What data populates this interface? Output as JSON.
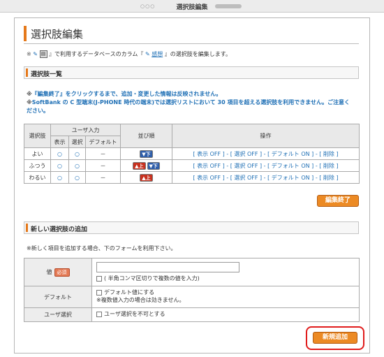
{
  "window": {
    "title": "選択肢編集"
  },
  "page": {
    "heading": "選択肢編集"
  },
  "intro": {
    "prefix": "※",
    "text_before_link": "』で利用するデータベースのカラム『",
    "link_label": "感想",
    "text_after_link": "』の選択肢を編集します。"
  },
  "section_list": {
    "title": "選択肢一覧"
  },
  "notes": [
    "『編集終了』をクリックするまで、追加・変更した情報は反映されません。",
    "SoftBank の C 型端末(J-PHONE 時代の端末)では選択リストにおいて 30 項目を超える選択肢を利用できません。ご注意ください。"
  ],
  "table": {
    "headers": {
      "choice": "選択肢",
      "user_input": "ユーザ入力",
      "display": "表示",
      "select": "選択",
      "default": "デフォルト",
      "order": "並び順",
      "operation": "操作"
    },
    "rows": [
      {
        "label": "よい",
        "display": "○",
        "select": "○",
        "default": "－",
        "order": [
          "▼下"
        ],
        "ops": {
          "show": "表示 OFF",
          "select": "選択 OFF",
          "default": "デフォルト ON",
          "delete": "削除"
        }
      },
      {
        "label": "ふつう",
        "display": "○",
        "select": "○",
        "default": "－",
        "order": [
          "▲上",
          "▼下"
        ],
        "ops": {
          "show": "表示 OFF",
          "select": "選択 OFF",
          "default": "デフォルト ON",
          "delete": "削除"
        }
      },
      {
        "label": "わるい",
        "display": "○",
        "select": "○",
        "default": "－",
        "order": [
          "▲上"
        ],
        "ops": {
          "show": "表示 OFF",
          "select": "選択 OFF",
          "default": "デフォルト ON",
          "delete": "削除"
        }
      }
    ]
  },
  "buttons": {
    "finish_edit": "編集終了",
    "add_new": "新規追加"
  },
  "section_add": {
    "title": "新しい選択肢の追加"
  },
  "add_note": "※新しく項目を追加する場合、下のフォームを利用下さい。",
  "form": {
    "value_label": "値",
    "required_badge": "必須",
    "value_input": "",
    "multi_value_checkbox": "( 半角コンマ区切りで複数の値を入力)",
    "default_label": "デフォルト",
    "default_checkbox": "デフォルト値にする",
    "default_note": "※複数値入力の場合は効きません。",
    "user_select_label": "ユーザ選択",
    "user_select_checkbox": "ユーザ選択を不可とする"
  },
  "colors": {
    "accent": "#ec8a24",
    "link": "#1e6fb5",
    "highlight": "#e01b1b"
  },
  "icons": {
    "db_icon": "database-icon",
    "pen_icon": "pen-icon"
  }
}
